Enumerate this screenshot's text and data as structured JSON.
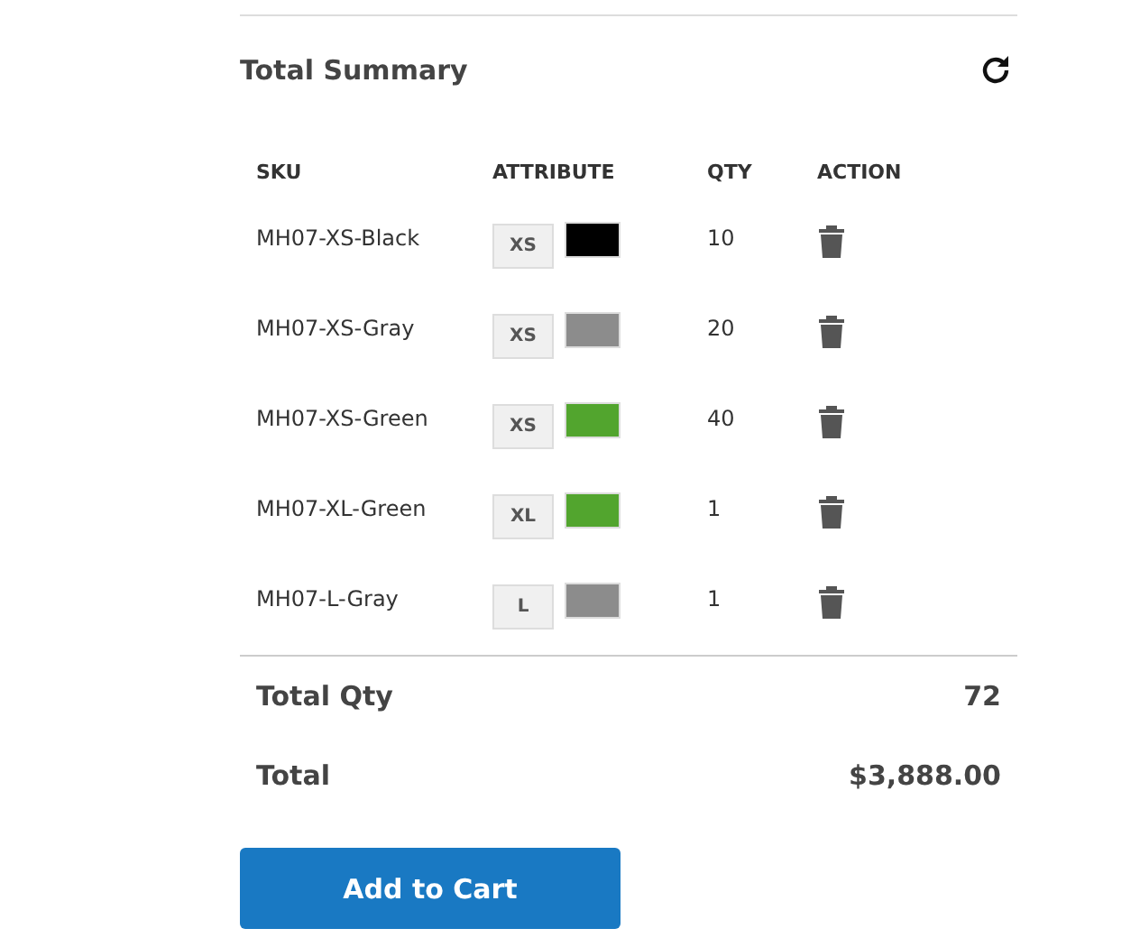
{
  "title": "Total Summary",
  "table": {
    "columns": [
      "SKU",
      "ATTRIBUTE",
      "QTY",
      "ACTION"
    ],
    "rows": [
      {
        "sku": "MH07-XS-Black",
        "size": "XS",
        "color": "#000000",
        "qty": "10"
      },
      {
        "sku": "MH07-XS-Gray",
        "size": "XS",
        "color": "#8c8c8c",
        "qty": "20"
      },
      {
        "sku": "MH07-XS-Green",
        "size": "XS",
        "color": "#52a52e",
        "qty": "40"
      },
      {
        "sku": "MH07-XL-Green",
        "size": "XL",
        "color": "#52a52e",
        "qty": "1"
      },
      {
        "sku": "MH07-L-Gray",
        "size": "L",
        "color": "#8c8c8c",
        "qty": "1"
      }
    ]
  },
  "totals": [
    {
      "label": "Total Qty",
      "value": "72"
    },
    {
      "label": "Total",
      "value": "$3,888.00"
    }
  ],
  "button": "Add to Cart"
}
